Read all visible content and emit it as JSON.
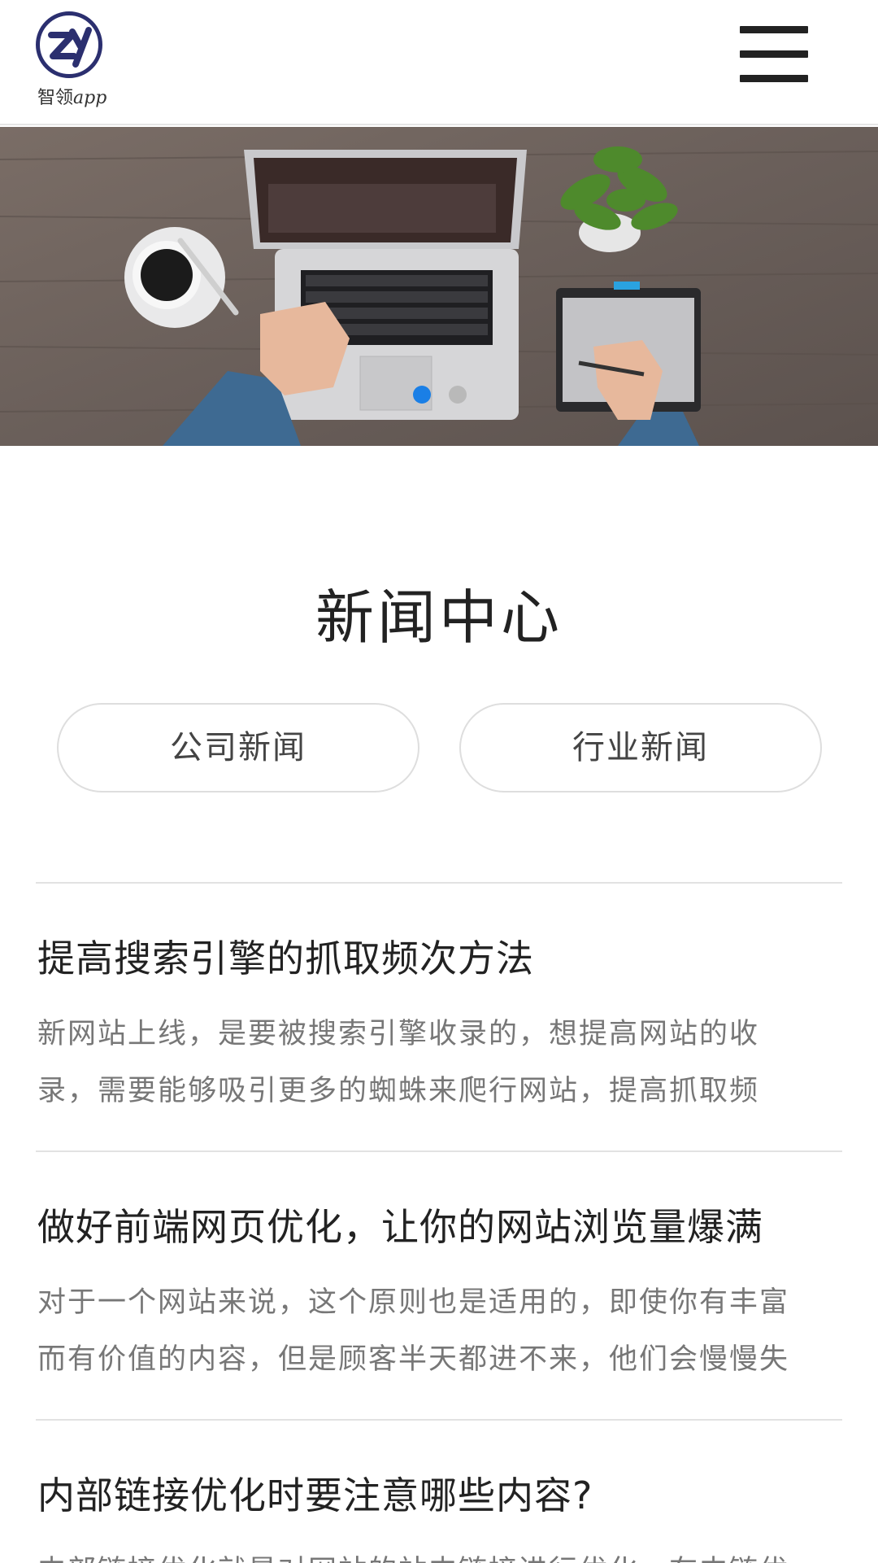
{
  "header": {
    "logo_brand": "智领",
    "logo_suffix": "app",
    "logo_mark_text": "ZY",
    "menu_icon": "hamburger-menu-icon"
  },
  "banner": {
    "image_desc": "banner-photo",
    "slides_total": 2,
    "active_slide": 1,
    "dot_active_color": "#1a7fe6",
    "dot_inactive_color": "#b9b9b9"
  },
  "section": {
    "title": "新闻中心"
  },
  "tabs": [
    {
      "label": "公司新闻"
    },
    {
      "label": "行业新闻"
    }
  ],
  "news": [
    {
      "title": "提高搜索引擎的抓取频次方法",
      "summary_lines": [
        "新网站上线，是要被搜索引擎收录的，想提高网站的收",
        "录，需要能够吸引更多的蜘蛛来爬行网站，提高抓取频"
      ]
    },
    {
      "title": "做好前端网页优化，让你的网站浏览量爆满",
      "summary_lines": [
        "对于一个网站来说，这个原则也是适用的，即使你有丰富",
        "而有价值的内容，但是顾客半天都进不来，他们会慢慢失"
      ]
    },
    {
      "title": "内部链接优化时要注意哪些内容?",
      "summary_lines": [
        "内部链接优化就是对网站的站内链接进行优化，在内链优"
      ]
    }
  ]
}
